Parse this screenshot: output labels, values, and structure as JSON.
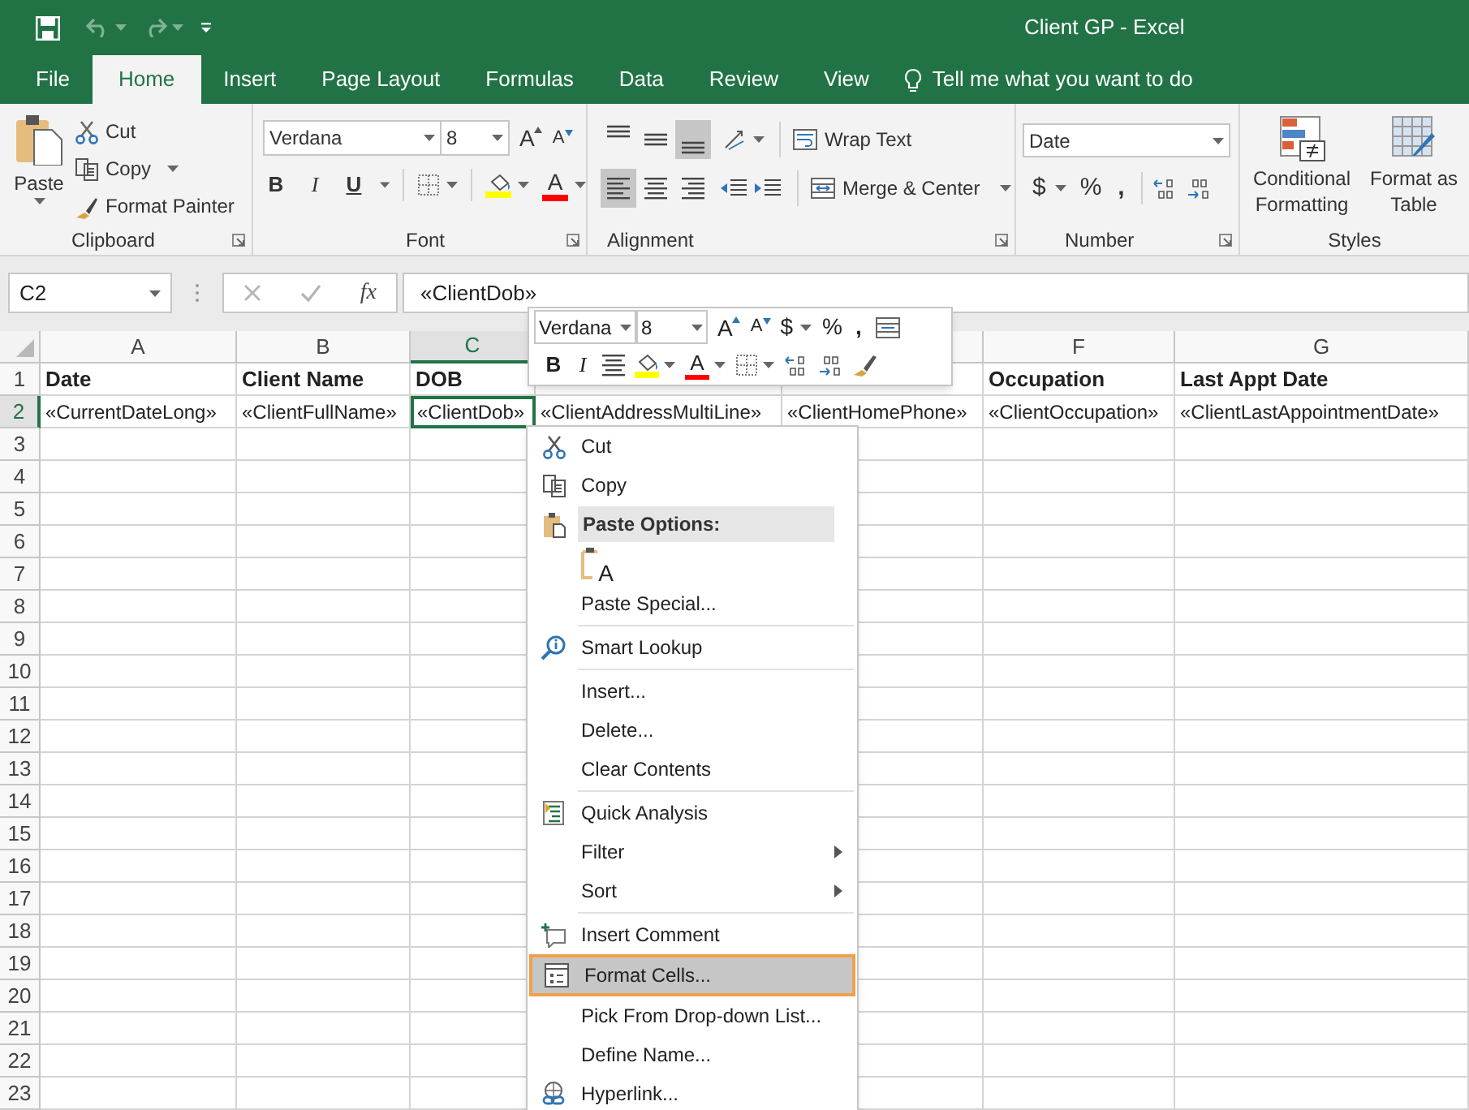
{
  "window": {
    "title": "Client GP - Excel"
  },
  "tabs": [
    {
      "label": "File",
      "selected": false
    },
    {
      "label": "Home",
      "selected": true
    },
    {
      "label": "Insert",
      "selected": false
    },
    {
      "label": "Page Layout",
      "selected": false
    },
    {
      "label": "Formulas",
      "selected": false
    },
    {
      "label": "Data",
      "selected": false
    },
    {
      "label": "Review",
      "selected": false
    },
    {
      "label": "View",
      "selected": false
    }
  ],
  "tell_me": {
    "placeholder": "Tell me what you want to do"
  },
  "ribbon": {
    "clipboard": {
      "label": "Clipboard",
      "paste": "Paste",
      "cut": "Cut",
      "copy": "Copy",
      "format_painter": "Format Painter"
    },
    "font": {
      "label": "Font",
      "font_name": "Verdana",
      "font_size": "8",
      "grow_font": "A",
      "shrink_font": "A",
      "bold": "B",
      "italic": "I",
      "underline": "U",
      "font_color": "A"
    },
    "alignment": {
      "label": "Alignment",
      "vertical_align": [
        {
          "selected": false
        },
        {
          "selected": false
        },
        {
          "selected": true
        }
      ],
      "horizontal_align": [
        {
          "selected": true
        },
        {
          "selected": false
        },
        {
          "selected": false
        }
      ],
      "wrap_text": "Wrap Text",
      "merge_center": "Merge & Center"
    },
    "number": {
      "label": "Number",
      "format": "Date",
      "currency": "$",
      "percent": "%",
      "comma": ","
    },
    "styles": {
      "label": "Styles",
      "conditional_formatting": "Conditional Formatting",
      "format_as_table": "Format as Table"
    }
  },
  "formula_bar": {
    "name_box": "C2",
    "function_label": "fx",
    "value": "«ClientDob»"
  },
  "sheet": {
    "columns": [
      {
        "letter": "A",
        "selected": false
      },
      {
        "letter": "B",
        "selected": false
      },
      {
        "letter": "C",
        "selected": true
      },
      null,
      null,
      {
        "letter": "F",
        "selected": false
      },
      {
        "letter": "G",
        "selected": false
      }
    ],
    "rows": [
      {
        "number": "1",
        "selected": false,
        "kind": "header",
        "cells": [
          "Date",
          "Client Name",
          "DOB",
          null,
          null,
          "Occupation",
          "Last Appt Date"
        ]
      },
      {
        "number": "2",
        "selected": true,
        "kind": "data",
        "cells": [
          "«CurrentDateLong»",
          "«ClientFullName»",
          "«ClientDob»",
          "«ClientAddressMultiLine»",
          "«ClientHomePhone»",
          "«ClientOccupation»",
          "«ClientLastAppointmentDate»"
        ]
      },
      {
        "number": "3",
        "selected": false
      },
      {
        "number": "4",
        "selected": false
      },
      {
        "number": "5",
        "selected": false
      },
      {
        "number": "6",
        "selected": false
      },
      {
        "number": "7",
        "selected": false
      },
      {
        "number": "8",
        "selected": false
      },
      {
        "number": "9",
        "selected": false
      },
      {
        "number": "10",
        "selected": false
      },
      {
        "number": "11",
        "selected": false
      },
      {
        "number": "12",
        "selected": false
      },
      {
        "number": "13",
        "selected": false
      },
      {
        "number": "14",
        "selected": false
      },
      {
        "number": "15",
        "selected": false
      },
      {
        "number": "16",
        "selected": false
      },
      {
        "number": "17",
        "selected": false
      },
      {
        "number": "18",
        "selected": false
      },
      {
        "number": "19",
        "selected": false
      },
      {
        "number": "20",
        "selected": false
      },
      {
        "number": "21",
        "selected": false
      },
      {
        "number": "22",
        "selected": false
      },
      {
        "number": "23",
        "selected": false
      }
    ]
  },
  "mini_toolbar": {
    "font_name": "Verdana",
    "font_size": "8",
    "grow_font": "A",
    "shrink_font": "A",
    "currency": "$",
    "percent": "%",
    "comma": ",",
    "bold": "B",
    "italic": "I",
    "font_color": "A"
  },
  "context_menu": {
    "groups": [
      {
        "items": [
          {
            "kind": "command",
            "label": "Cut",
            "selected": false
          },
          {
            "kind": "command",
            "label": "Copy",
            "selected": false
          },
          {
            "kind": "header",
            "label": "Paste Options:",
            "selected": false
          },
          {
            "kind": "paste_option",
            "label": "A",
            "selected": false
          },
          {
            "kind": "command",
            "label": "Paste Special...",
            "selected": false
          }
        ]
      },
      {
        "items": [
          {
            "kind": "command",
            "label": "Smart Lookup",
            "selected": false
          }
        ]
      },
      {
        "items": [
          {
            "kind": "command",
            "label": "Insert...",
            "selected": false
          },
          {
            "kind": "command",
            "label": "Delete...",
            "selected": false
          },
          {
            "kind": "command",
            "label": "Clear Contents",
            "selected": false
          }
        ]
      },
      {
        "items": [
          {
            "kind": "command",
            "label": "Quick Analysis",
            "selected": false
          },
          {
            "kind": "command",
            "label": "Filter",
            "submenu": true,
            "selected": false
          },
          {
            "kind": "command",
            "label": "Sort",
            "submenu": true,
            "selected": false
          }
        ]
      },
      {
        "items": [
          {
            "kind": "command",
            "label": "Insert Comment",
            "selected": false
          },
          {
            "kind": "command",
            "label": "Format Cells...",
            "selected": true
          },
          {
            "kind": "command",
            "label": "Pick From Drop-down List...",
            "selected": false
          },
          {
            "kind": "command",
            "label": "Define Name...",
            "selected": false
          },
          {
            "kind": "command",
            "label": "Hyperlink...",
            "selected": false
          }
        ]
      }
    ]
  }
}
